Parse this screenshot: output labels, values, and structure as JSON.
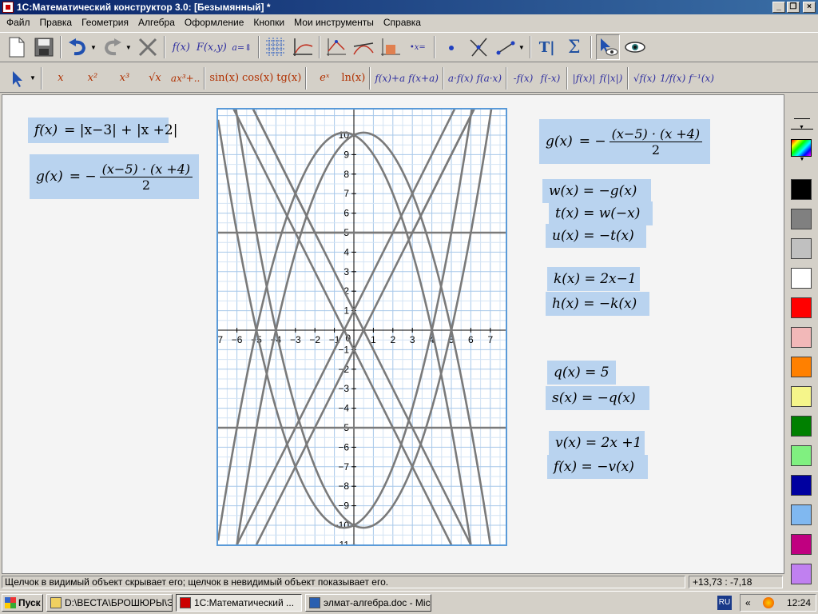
{
  "window": {
    "title": "1С:Математический конструктор 3.0: [Безымянный] *"
  },
  "menu": [
    "Файл",
    "Правка",
    "Геометрия",
    "Алгебра",
    "Оформление",
    "Кнопки",
    "Мои инструменты",
    "Справка"
  ],
  "toolbar2": {
    "powers": [
      "x",
      "x²",
      "x³",
      "√x",
      "ax³+.."
    ],
    "trig": [
      "sin(x)",
      "cos(x)",
      "tg(x)"
    ],
    "exp": [
      "eˣ",
      "ln(x)"
    ],
    "shifts": [
      "f(x)+a",
      "f(x+a)"
    ],
    "scales": [
      "a·f(x)",
      "f(a·x)"
    ],
    "reflect": [
      "-f(x)",
      "f(-x)"
    ],
    "abs": [
      "|f(x)|",
      "f(|x|)"
    ],
    "inv": [
      "√f(x)",
      "1/f(x)",
      "f⁻¹(x)"
    ]
  },
  "formulas_left": {
    "f_name": "f(x)",
    "f_expr": "= |x−3| + |x +2|",
    "g_name": "g(x)",
    "g_lhs": "= −",
    "g_num": "(x−5) · (x +4)",
    "g_den": "2"
  },
  "formulas_right": {
    "g_name": "g(x)",
    "g_lhs": "= −",
    "g_num": "(x−5) · (x +4)",
    "g_den": "2",
    "w": "w(x) = −g(x)",
    "t": "t(x) = w(−x)",
    "u": "u(x) = −t(x)",
    "k": "k(x) = 2x−1",
    "h": "h(x) = −k(x)",
    "q": "q(x) = 5",
    "s": "s(x) = −q(x)",
    "v": "v(x) = 2x +1",
    "f": "f(x) = −v(x)"
  },
  "chart_data": {
    "type": "line",
    "xlim": [
      -7,
      7
    ],
    "ylim": [
      -11,
      10
    ],
    "x_ticks": [
      -7,
      -6,
      -5,
      -4,
      -3,
      -2,
      -1,
      1,
      2,
      3,
      4,
      5,
      6,
      7
    ],
    "y_ticks": [
      10,
      9,
      8,
      7,
      6,
      5,
      4,
      3,
      2,
      1,
      -1,
      -2,
      -3,
      -4,
      -5,
      -6,
      -7,
      -8,
      -9,
      -10,
      -11
    ],
    "grid": true,
    "series": [
      {
        "expr": "|x-3|+|x+2|"
      },
      {
        "expr": "-(x-5)(x+4)/2"
      },
      {
        "expr": "(x-5)(x+4)/2"
      },
      {
        "expr": "(x+5)(x-4)/2"
      },
      {
        "expr": "-(x+5)(x-4)/2"
      },
      {
        "expr": "2x-1"
      },
      {
        "expr": "-2x+1"
      },
      {
        "expr": "5"
      },
      {
        "expr": "-5"
      },
      {
        "expr": "2x+1"
      },
      {
        "expr": "-2x-1"
      }
    ]
  },
  "colors": [
    "#000000",
    "#808080",
    "#c0c0c0",
    "#ffffff",
    "#ff0000",
    "#f2b8b8",
    "#ff8000",
    "#f5f58a",
    "#008000",
    "#80f080",
    "#0000a0",
    "#80b8f0",
    "#c00080",
    "#c080f0"
  ],
  "status": {
    "message": "Щелчок в видимый объект скрывает его; щелчок в невидимый объект показывает его.",
    "coords": "+13,73 : -7,18"
  },
  "taskbar": {
    "start": "Пуск",
    "tasks": [
      "D:\\ВЕСТА\\БРОШЮРЫ\\Э...",
      "1С:Математический ...",
      "элмат-алгебра.doc - Mic..."
    ],
    "lang": "RU",
    "clock": "12:24"
  }
}
